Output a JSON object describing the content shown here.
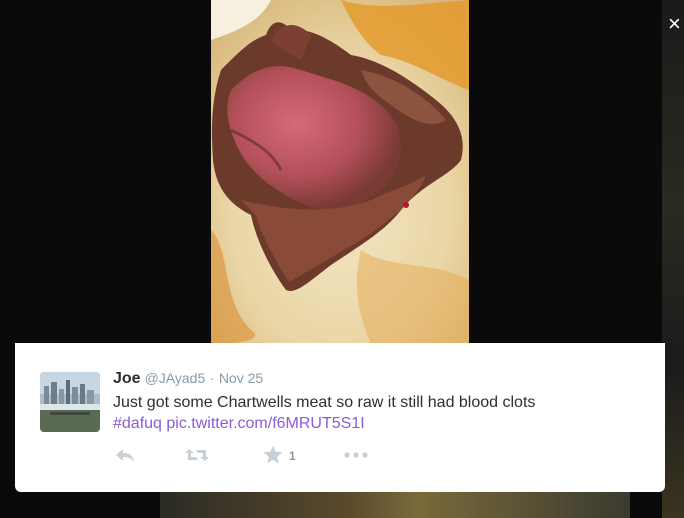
{
  "tweet": {
    "name": "Joe",
    "handle": "@JAyad5",
    "separator": "·",
    "date": "Nov 25",
    "text": "Just got some Chartwells meat so raw it still had blood clots",
    "hashtag": "#dafuq",
    "pic_link": "pic.twitter.com/f6MRUT5S1I",
    "favorite_count": "1"
  },
  "overlay": {
    "close_icon": "close-icon",
    "close_label": "×"
  },
  "icons": {
    "reply": "reply-icon",
    "retweet": "retweet-icon",
    "favorite": "star-icon",
    "more": "more-icon"
  },
  "colors": {
    "link": "#8b5cd6",
    "muted": "#8899a6",
    "text": "#292f33"
  }
}
